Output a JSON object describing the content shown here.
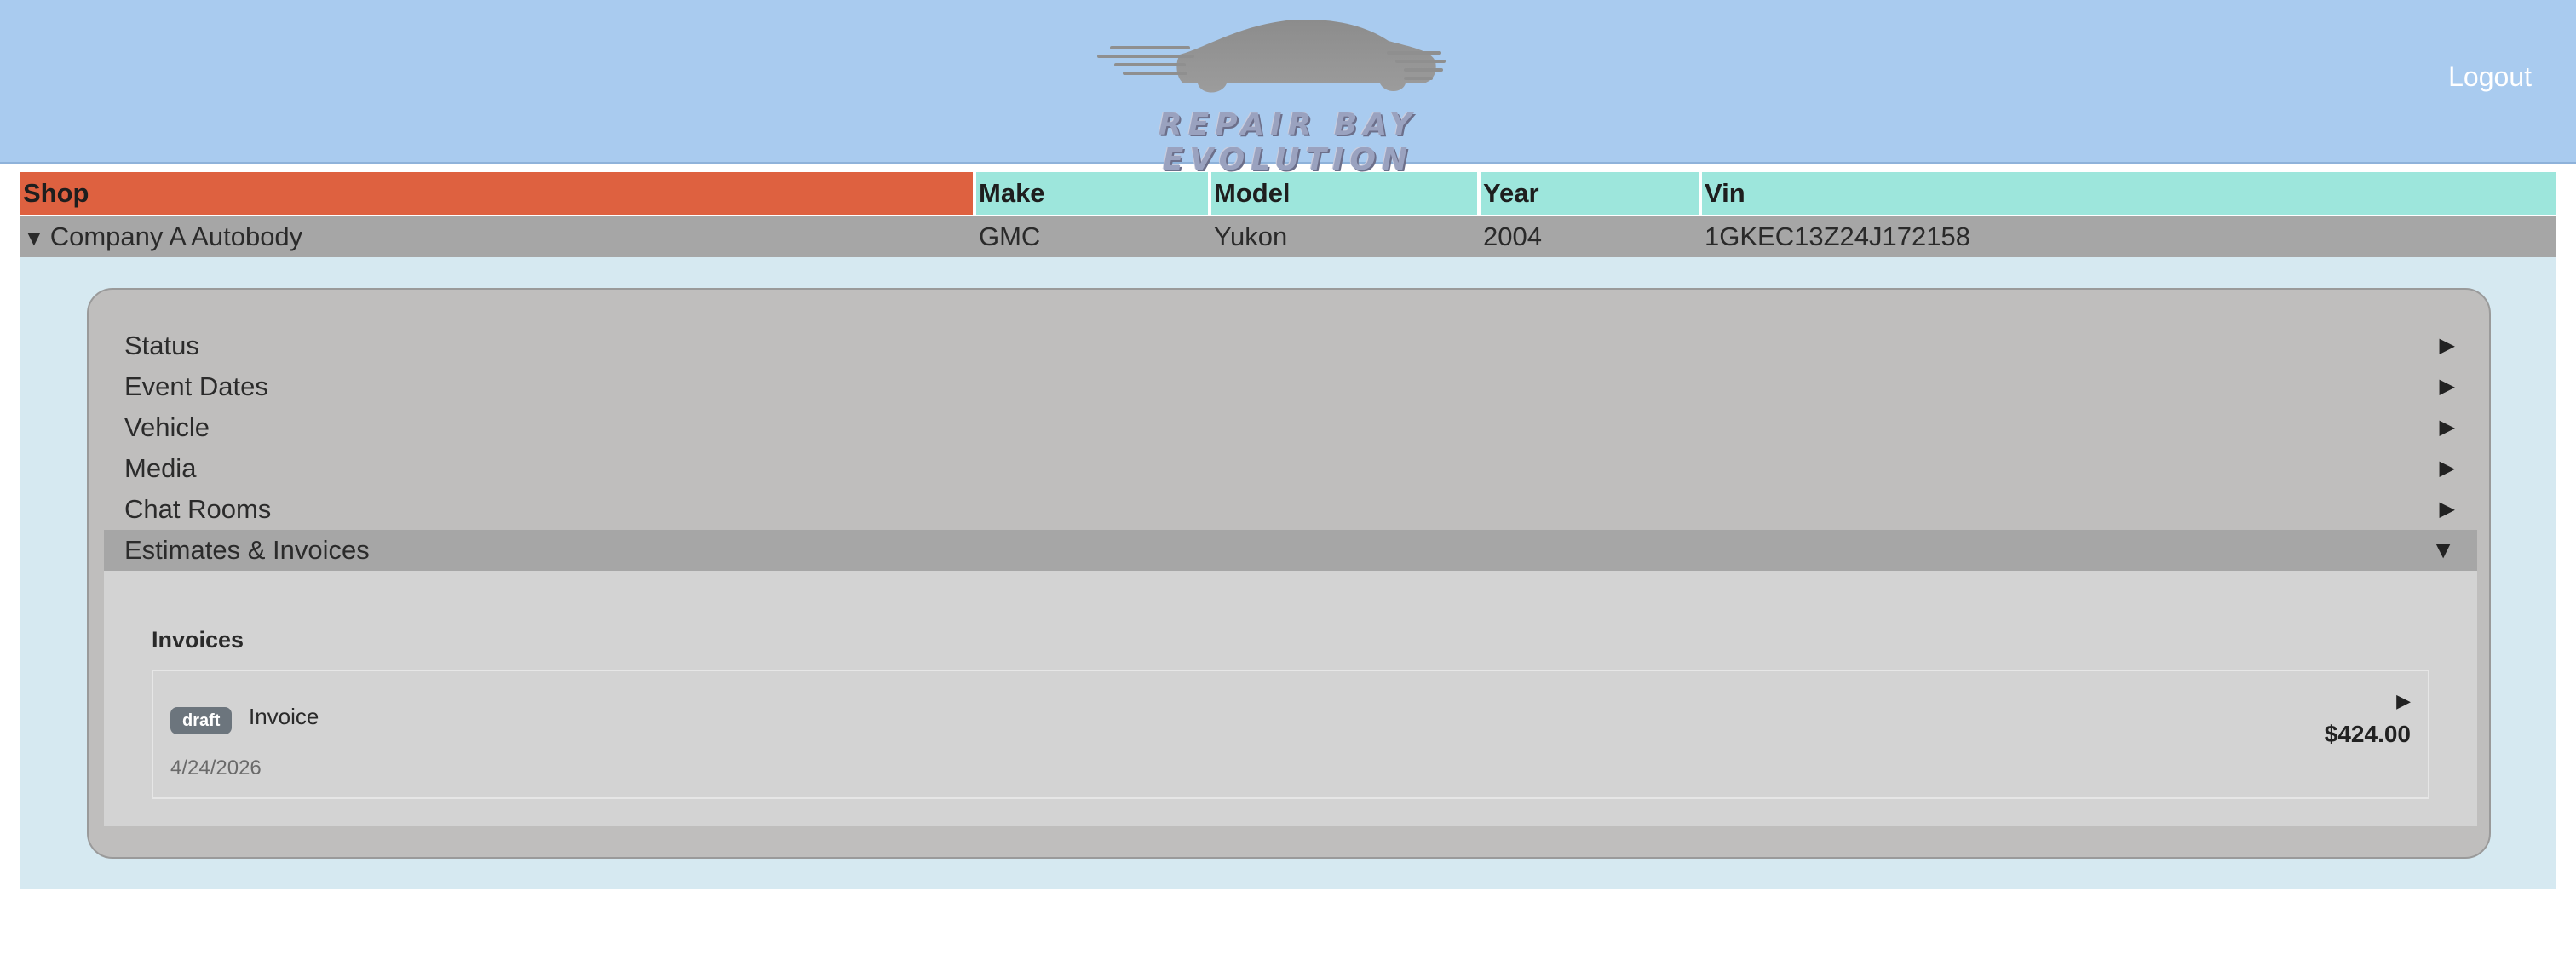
{
  "header": {
    "logo_text": "REPAIR BAY EVOLUTION",
    "logout_label": "Logout",
    "background_color": "#a9cbef"
  },
  "table": {
    "columns": {
      "shop": "Shop",
      "make": "Make",
      "model": "Model",
      "year": "Year",
      "vin": "Vin"
    },
    "row": {
      "expand_icon": "▼",
      "shop": "Company A Autobody",
      "make": "GMC",
      "model": "Yukon",
      "year": "2004",
      "vin": "1GKEC13Z24J172158"
    },
    "colors": {
      "shop_header": "#de6140",
      "column_header": "#9de6dc",
      "row": "#a6a6a6"
    }
  },
  "details": {
    "sections": [
      {
        "label": "Status",
        "icon": "▶"
      },
      {
        "label": "Event Dates",
        "icon": "▶"
      },
      {
        "label": "Vehicle",
        "icon": "▶"
      },
      {
        "label": "Media",
        "icon": "▶"
      },
      {
        "label": "Chat Rooms",
        "icon": "▶"
      },
      {
        "label": "Estimates & Invoices",
        "icon": "▼"
      }
    ],
    "invoices": {
      "title": "Invoices",
      "items": [
        {
          "badge": "draft",
          "label": "Invoice",
          "date": "4/24/2026",
          "amount": "$424.00",
          "arrow": "▶"
        }
      ]
    }
  }
}
